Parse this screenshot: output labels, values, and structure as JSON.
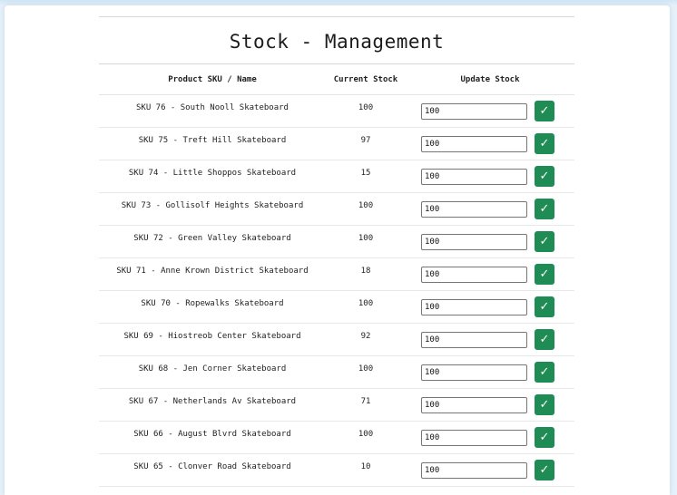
{
  "title": "Stock - Management",
  "columns": {
    "name": "Product SKU / Name",
    "stock": "Current Stock",
    "update": "Update Stock"
  },
  "confirm_glyph": "✓",
  "accent_color": "#1f8c55",
  "rows": [
    {
      "name": "SKU 76 - South Nooll Skateboard",
      "stock": "100",
      "input": "100"
    },
    {
      "name": "SKU 75 - Treft Hill Skateboard",
      "stock": "97",
      "input": "100"
    },
    {
      "name": "SKU 74 - Little Shoppos Skateboard",
      "stock": "15",
      "input": "100"
    },
    {
      "name": "SKU 73 - Gollisolf Heights Skateboard",
      "stock": "100",
      "input": "100"
    },
    {
      "name": "SKU 72 - Green Valley Skateboard",
      "stock": "100",
      "input": "100"
    },
    {
      "name": "SKU 71 - Anne Krown District Skateboard",
      "stock": "18",
      "input": "100"
    },
    {
      "name": "SKU 70 - Ropewalks Skateboard",
      "stock": "100",
      "input": "100"
    },
    {
      "name": "SKU 69 - Hiostreob Center Skateboard",
      "stock": "92",
      "input": "100"
    },
    {
      "name": "SKU 68 - Jen Corner Skateboard",
      "stock": "100",
      "input": "100"
    },
    {
      "name": "SKU 67 - Netherlands Av Skateboard",
      "stock": "71",
      "input": "100"
    },
    {
      "name": "SKU 66 - August Blvrd Skateboard",
      "stock": "100",
      "input": "100"
    },
    {
      "name": "SKU 65 - Clonver Road Skateboard",
      "stock": "10",
      "input": "100"
    }
  ]
}
